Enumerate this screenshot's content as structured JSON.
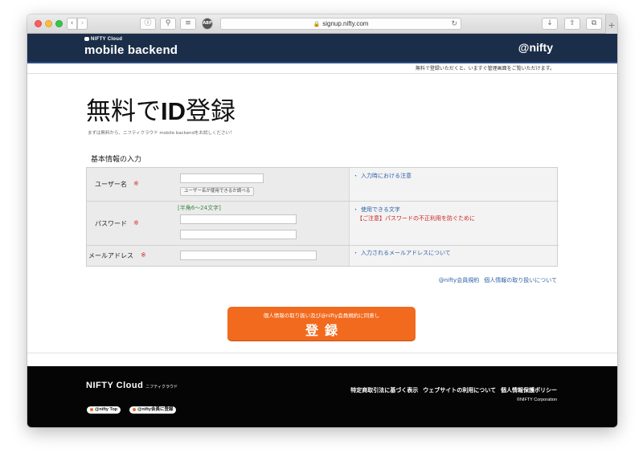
{
  "browser": {
    "url": "signup.nifty.com",
    "icons": {
      "back": "chevron-left-icon",
      "forward": "chevron-right-icon",
      "info": "info-icon",
      "password": "key-icon",
      "layers": "layers-icon",
      "adblock": "abp-icon",
      "download": "download-icon",
      "share": "share-icon",
      "tabs": "tabs-icon",
      "new_tab": "plus-icon"
    }
  },
  "header": {
    "logo_top": "NIFTY Cloud",
    "logo_main": "mobile backend",
    "brand": "@nifty",
    "note": "無料で登録いただくと、いますぐ管理画面をご覧いただけます。",
    "bg_color": "#1b2e49"
  },
  "title": {
    "part1": "無料で",
    "part2": "ID",
    "part3": "登録",
    "subtitle": "まずは無料から、ニフティクラウド mobile backendをお試しください！"
  },
  "form": {
    "section_title": "基本情報の入力",
    "required_mark": "※",
    "username": {
      "label": "ユーザー名",
      "value": "",
      "check_button": "ユーザー名が使用できるか調べる",
      "note": "入力時における注意"
    },
    "password": {
      "label": "パスワード",
      "hint": "[半角6～24文字]",
      "value": "",
      "confirm_value": "",
      "note": "使用できる文字",
      "warning": "【ご注意】パスワードの不正利用を防ぐために"
    },
    "email": {
      "label": "メールアドレス",
      "value": "",
      "note": "入力されるメールアドレスについて"
    }
  },
  "links": {
    "terms": "@nifty会員規約",
    "privacy": "個人情報の取り扱いについて"
  },
  "submit": {
    "sub": "個人情報の取り扱い及び@nifty会員規約に同意し",
    "main": "登録",
    "color": "#f26a1e"
  },
  "footer": {
    "logo": "NIFTY Cloud",
    "logo_kana": "ニフティクラウド",
    "links": [
      "特定商取引法に基づく表示",
      "ウェブサイトの利用について",
      "個人情報保護ポリシー"
    ],
    "copyright": "©NIFTY Corporation",
    "pills": [
      "@nifty Top",
      "@nifty会員に登録"
    ]
  }
}
